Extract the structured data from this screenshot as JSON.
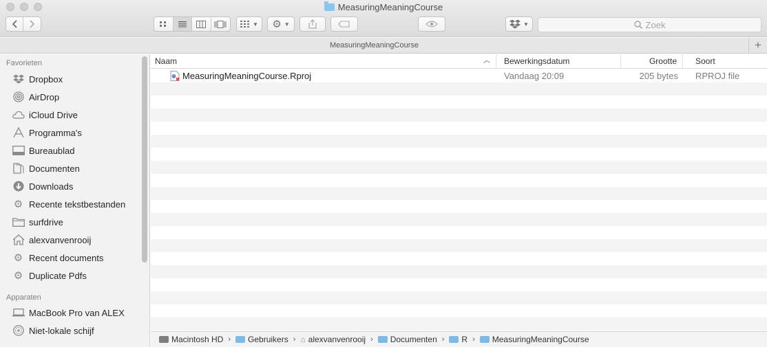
{
  "window": {
    "title": "MeasuringMeaningCourse"
  },
  "toolbar": {
    "search_placeholder": "Zoek",
    "accent": "#8cc6ef"
  },
  "tabbar": {
    "title": "MeasuringMeaningCourse",
    "add": "+"
  },
  "sidebar": {
    "favorites_header": "Favorieten",
    "favorites": [
      {
        "label": "Dropbox",
        "icon": "dropbox-icon"
      },
      {
        "label": "AirDrop",
        "icon": "airdrop-icon"
      },
      {
        "label": "iCloud Drive",
        "icon": "cloud-icon"
      },
      {
        "label": "Programma's",
        "icon": "applications-icon"
      },
      {
        "label": "Bureaublad",
        "icon": "desktop-icon"
      },
      {
        "label": "Documenten",
        "icon": "documents-icon"
      },
      {
        "label": "Downloads",
        "icon": "downloads-icon"
      },
      {
        "label": "Recente tekstbestanden",
        "icon": "gear-icon"
      },
      {
        "label": "surfdrive",
        "icon": "folder-icon"
      },
      {
        "label": "alexvanvenrooij",
        "icon": "home-icon"
      },
      {
        "label": "Recent documents",
        "icon": "gear-icon"
      },
      {
        "label": "Duplicate Pdfs",
        "icon": "gear-icon"
      }
    ],
    "devices_header": "Apparaten",
    "devices": [
      {
        "label": "MacBook Pro van ALEX",
        "icon": "laptop-icon"
      },
      {
        "label": "Niet-lokale schijf",
        "icon": "disc-icon"
      }
    ]
  },
  "columns": {
    "name": "Naam",
    "date": "Bewerkingsdatum",
    "size": "Grootte",
    "kind": "Soort"
  },
  "files": [
    {
      "name": "MeasuringMeaningCourse.Rproj",
      "date": "Vandaag 20:09",
      "size": "205 bytes",
      "kind": "RPROJ file"
    }
  ],
  "pathbar": {
    "crumbs": [
      {
        "label": "Macintosh HD",
        "icon": "harddisk-icon"
      },
      {
        "label": "Gebruikers",
        "icon": "folder-icon"
      },
      {
        "label": "alexvanvenrooij",
        "icon": "home-icon"
      },
      {
        "label": "Documenten",
        "icon": "folder-icon"
      },
      {
        "label": "R",
        "icon": "folder-icon"
      },
      {
        "label": "MeasuringMeaningCourse",
        "icon": "folder-icon"
      }
    ]
  }
}
